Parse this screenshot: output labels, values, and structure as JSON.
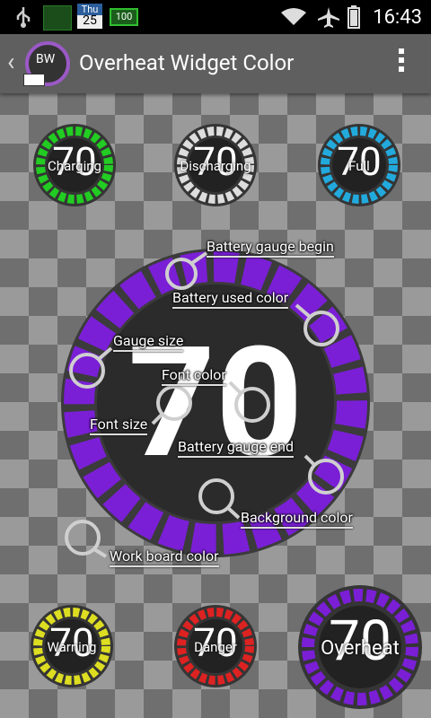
{
  "status_bar": {
    "time": "16:43",
    "calendar_day": "Thu",
    "calendar_date": "25",
    "battery_badge": "100"
  },
  "app_bar": {
    "title": "Overheat Widget Color",
    "app_icon_text": "BW"
  },
  "widgets": {
    "charging": {
      "value": "70",
      "label": "Charging",
      "color": "#22cc22"
    },
    "discharging": {
      "value": "70",
      "label": "Discharging",
      "color": "#dddddd"
    },
    "full": {
      "value": "70",
      "label": "Full",
      "color": "#22aadd"
    },
    "warning": {
      "value": "70",
      "label": "Warning",
      "color": "#dddd22"
    },
    "danger": {
      "value": "70",
      "label": "Danger",
      "color": "#dd2222"
    },
    "overheat": {
      "value": "70",
      "label": "Overheat",
      "color": "#7a1fd6"
    }
  },
  "main_gauge": {
    "value": "70",
    "color": "#7a1fd6",
    "handles": {
      "battery_gauge_begin": "Battery gauge begin",
      "battery_used_color": "Battery used color",
      "gauge_size": "Gauge size",
      "font_color": "Font color",
      "font_size": "Font size",
      "battery_gauge_end": "Battery gauge end",
      "background_color": "Background color",
      "work_board_color": "Work board color"
    }
  }
}
